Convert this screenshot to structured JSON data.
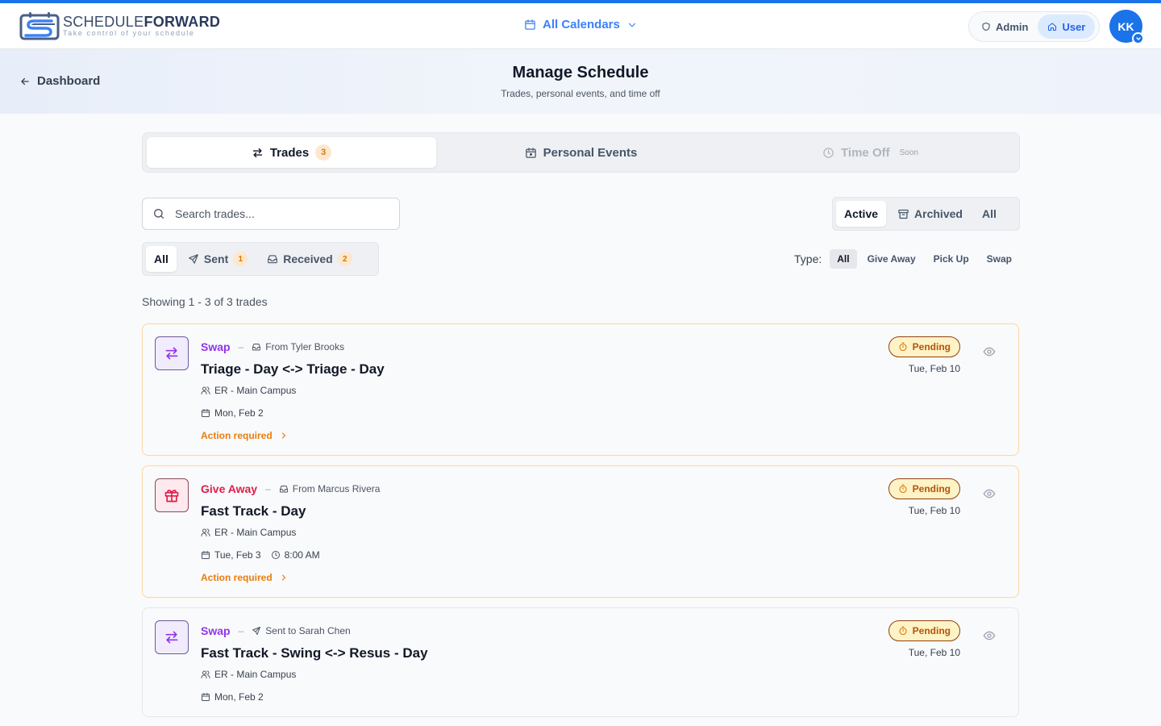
{
  "app": {
    "brand_light": "SCHEDULE",
    "brand_bold": "FORWARD",
    "tagline": "Take control of your schedule",
    "calendar_selector": "All Calendars",
    "roles": {
      "admin": "Admin",
      "user": "User"
    },
    "avatar_initials": "KK"
  },
  "nav": {
    "back_label": "Dashboard"
  },
  "page": {
    "title": "Manage Schedule",
    "subtitle": "Trades, personal events, and time off"
  },
  "tabs": [
    {
      "label": "Trades",
      "count": "3"
    },
    {
      "label": "Personal Events"
    },
    {
      "label": "Time Off",
      "tag": "Soon"
    }
  ],
  "search": {
    "placeholder": "Search trades..."
  },
  "status_filter": {
    "active": "Active",
    "archived": "Archived",
    "all": "All"
  },
  "direction_filter": {
    "all": "All",
    "sent": "Sent",
    "sent_count": "1",
    "received": "Received",
    "received_count": "2"
  },
  "type_filter": {
    "label": "Type:",
    "options": [
      "All",
      "Give Away",
      "Pick Up",
      "Swap"
    ]
  },
  "results": {
    "showing": "Showing 1 - 3 of 3 trades"
  },
  "trades": [
    {
      "type": "Swap",
      "direction": "From Tyler Brooks",
      "title": "Triage - Day <-> Triage - Day",
      "location": "ER - Main Campus",
      "date": "Mon, Feb 2",
      "action": "Action required",
      "status": "Pending",
      "status_date": "Tue, Feb 10"
    },
    {
      "type": "Give Away",
      "direction": "From Marcus Rivera",
      "title": "Fast Track - Day",
      "location": "ER - Main Campus",
      "date": "Tue, Feb 3",
      "time": "8:00 AM",
      "action": "Action required",
      "status": "Pending",
      "status_date": "Tue, Feb 10"
    },
    {
      "type": "Swap",
      "direction": "Sent to Sarah Chen",
      "title": "Fast Track - Swing <-> Resus - Day",
      "location": "ER - Main Campus",
      "date": "Mon, Feb 2",
      "status": "Pending",
      "status_date": "Tue, Feb 10"
    }
  ],
  "colors": {
    "primary": "#1a73e8",
    "swap": "#9333ea",
    "give_away": "#e11d48",
    "pending": "#b45309",
    "action": "#ea7c0c"
  },
  "icons": [
    "calendar-icon",
    "chevron-down-icon",
    "shield-icon",
    "home-icon",
    "check-icon",
    "arrow-left-icon",
    "swap-arrows-icon",
    "calendar-event-icon",
    "clock-icon",
    "search-icon",
    "archive-icon",
    "send-icon",
    "inbox-icon",
    "gift-icon",
    "users-icon",
    "chevron-right-icon",
    "timer-icon",
    "eye-icon"
  ]
}
